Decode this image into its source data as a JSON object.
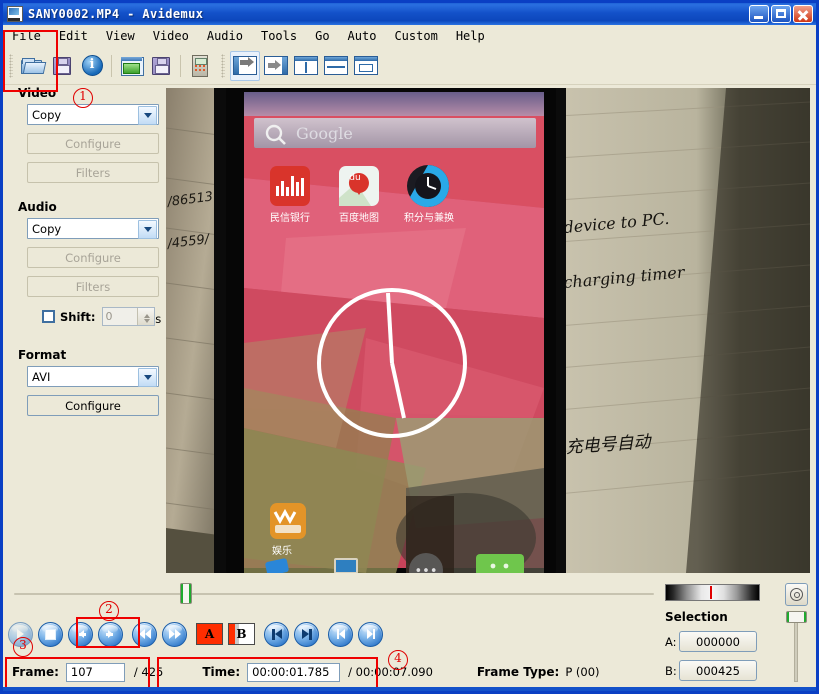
{
  "window": {
    "title": "SANY0002.MP4 - Avidemux",
    "icon": "avidemux-icon",
    "buttons": {
      "minimize": "minimize-button",
      "maximize": "maximize-button",
      "close": "close-button"
    }
  },
  "menubar": {
    "items": [
      {
        "label": "File"
      },
      {
        "label": "Edit"
      },
      {
        "label": "View"
      },
      {
        "label": "Video"
      },
      {
        "label": "Audio"
      },
      {
        "label": "Tools"
      },
      {
        "label": "Go"
      },
      {
        "label": "Auto"
      },
      {
        "label": "Custom"
      },
      {
        "label": "Help"
      }
    ]
  },
  "toolbar": {
    "items": [
      {
        "name": "open-file-icon"
      },
      {
        "name": "save-file-icon"
      },
      {
        "name": "file-info-icon"
      },
      {
        "name": "open-project-icon"
      },
      {
        "name": "save-project-icon"
      },
      {
        "name": "calculator-icon"
      },
      {
        "name": "output-format-icon",
        "selected": true
      },
      {
        "name": "output-target-icon"
      },
      {
        "name": "view-split-vertical-icon"
      },
      {
        "name": "view-split-horizontal-icon"
      },
      {
        "name": "view-single-icon"
      }
    ]
  },
  "sidebar": {
    "video": {
      "heading": "Video",
      "codec": "Copy",
      "configure_label": "Configure",
      "filters_label": "Filters"
    },
    "audio": {
      "heading": "Audio",
      "codec": "Copy",
      "configure_label": "Configure",
      "filters_label": "Filters",
      "shift_label": "Shift:",
      "shift_value": "0",
      "shift_checked": false,
      "shift_unit": "ms"
    },
    "format": {
      "heading": "Format",
      "container": "AVI",
      "configure_label": "Configure"
    }
  },
  "preview": {
    "description": "Video frame: camera recording of an Android phone home screen lying on a lined notebook",
    "phone_screen": {
      "search_placeholder": "Google",
      "app_labels": [
        "民信银行",
        "百度地图",
        "积分与兑换",
        "娱乐"
      ]
    },
    "notebook_text": [
      "device to PC.",
      "charging timer",
      "充电号自动开"
    ]
  },
  "timeline": {
    "position_percent": 26
  },
  "navigation": {
    "buttons": [
      {
        "name": "play-button",
        "glyph": "play"
      },
      {
        "name": "stop-button",
        "glyph": "stop"
      },
      {
        "name": "previous-frame-button",
        "glyph": "arrow-left"
      },
      {
        "name": "next-frame-button",
        "glyph": "arrow-right"
      },
      {
        "name": "rewind-button",
        "glyph": "double-left"
      },
      {
        "name": "forward-button",
        "glyph": "double-right"
      },
      {
        "name": "mark-a-button",
        "glyph": "mark-a",
        "label": "A"
      },
      {
        "name": "mark-b-button",
        "glyph": "mark-b",
        "label": "B"
      },
      {
        "name": "go-to-start-button",
        "glyph": "bar-left"
      },
      {
        "name": "go-to-end-button",
        "glyph": "bar-right"
      },
      {
        "name": "previous-keyframe-button",
        "glyph": "keyframe-left"
      },
      {
        "name": "next-keyframe-button",
        "glyph": "keyframe-right"
      }
    ]
  },
  "status": {
    "frame_label": "Frame:",
    "frame_value": "107",
    "frame_total": "/ 425",
    "time_label": "Time:",
    "time_value": "00:00:01.785",
    "time_total": "/ 00:00:07.090",
    "frame_type_label": "Frame Type:",
    "frame_type_value": "P (00)"
  },
  "selection": {
    "heading": "Selection",
    "a_label": "A:",
    "a_value": "000000",
    "b_label": "B:",
    "b_value": "000425",
    "volume_icon": "speaker-icon"
  },
  "annotations": [
    {
      "id": 1,
      "marker": "①"
    },
    {
      "id": 2,
      "marker": "②"
    },
    {
      "id": 3,
      "marker": "③"
    },
    {
      "id": 4,
      "marker": "④"
    }
  ],
  "colors": {
    "title_gradient_start": "#2a6fe0",
    "title_gradient_end": "#0c47bc",
    "panel_bg": "#ece9d8",
    "annotation_red": "#ef0000",
    "accent_blue": "#2a74c8"
  }
}
